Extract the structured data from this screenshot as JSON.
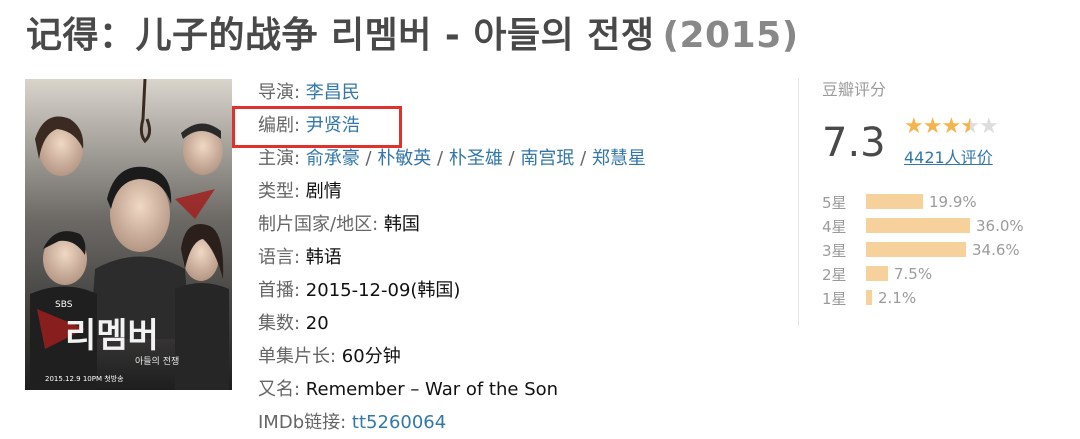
{
  "header": {
    "title": "记得：儿子的战争 리멤버 - 아들의 전쟁",
    "year": "(2015)"
  },
  "poster": {
    "top_caption": "SBS",
    "logo_text": "리멤버",
    "logo_sub": "아들의 전쟁",
    "date_text": "2015.12.9 10PM 첫방송"
  },
  "info": {
    "director_label": "导演",
    "director": "李昌民",
    "writer_label": "编剧",
    "writer": "尹贤浩",
    "cast_label": "主演",
    "cast": [
      "俞承豪",
      "朴敏英",
      "朴圣雄",
      "南宫珉",
      "郑慧星"
    ],
    "genre_label": "类型",
    "genre": "剧情",
    "country_label": "制片国家/地区",
    "country": "韩国",
    "language_label": "语言",
    "language": "韩语",
    "premiere_label": "首播",
    "premiere": "2015-12-09(韩国)",
    "episodes_label": "集数",
    "episodes": "20",
    "runtime_label": "单集片长",
    "runtime": "60分钟",
    "aka_label": "又名",
    "aka": "Remember – War of the Son",
    "imdb_label": "IMDb链接",
    "imdb": "tt5260064"
  },
  "rating": {
    "label": "豆瓣评分",
    "score": "7.3",
    "stars_value": 3.5,
    "votes": "4421人评价",
    "distribution": [
      {
        "label": "5星",
        "percent_text": "19.9%",
        "value": 19.9
      },
      {
        "label": "4星",
        "percent_text": "36.0%",
        "value": 36.0
      },
      {
        "label": "3星",
        "percent_text": "34.6%",
        "value": 34.6
      },
      {
        "label": "2星",
        "percent_text": "7.5%",
        "value": 7.5
      },
      {
        "label": "1星",
        "percent_text": "2.1%",
        "value": 2.1
      }
    ],
    "bar_color": "#f7d19c",
    "star_color": "#f5b54d"
  },
  "colors": {
    "link": "#3377aa",
    "highlight": "#e0322b"
  }
}
